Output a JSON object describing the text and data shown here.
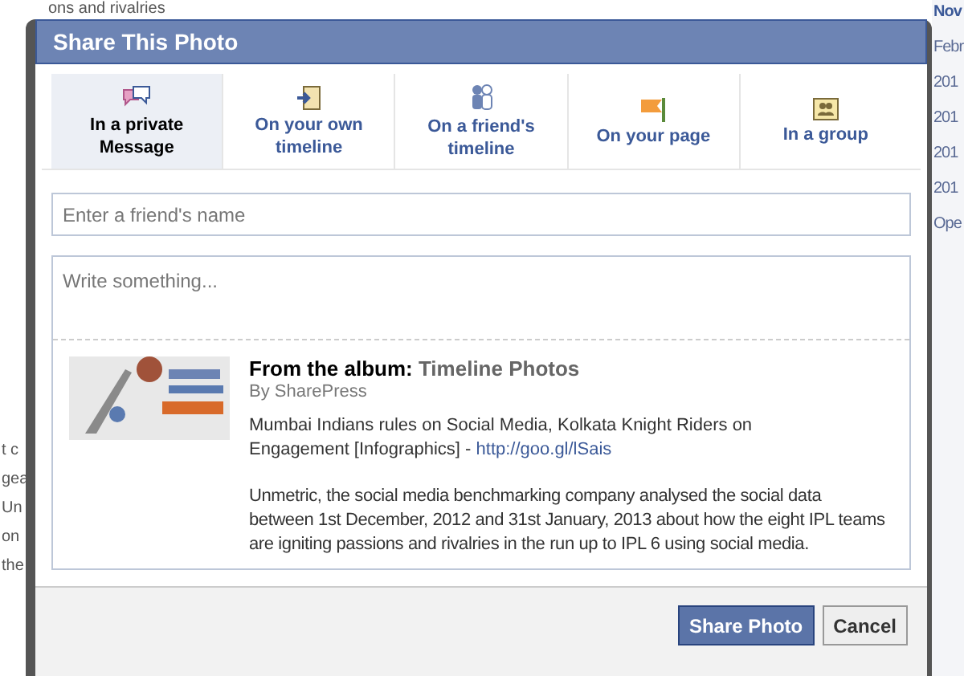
{
  "background": {
    "top_fragment": "ons and rivalries",
    "left_fragments": [
      "t c",
      "gea",
      "Un",
      "on",
      "the"
    ],
    "right_fragments": [
      "Nov",
      "Febr",
      "201",
      "201",
      "201",
      "201",
      "Ope"
    ]
  },
  "dialog": {
    "title": "Share This Photo",
    "tabs": [
      {
        "label": "In a private Message",
        "selected": true,
        "kind": "message"
      },
      {
        "label": "On your own timeline",
        "selected": false,
        "kind": "timeline"
      },
      {
        "label": "On a friend's timeline",
        "selected": false,
        "kind": "friend"
      },
      {
        "label": "On your page",
        "selected": false,
        "kind": "page"
      },
      {
        "label": "In a group",
        "selected": false,
        "kind": "group"
      }
    ],
    "friend_field": {
      "placeholder": "Enter a friend's name"
    },
    "message_field": {
      "placeholder": "Write something..."
    },
    "attachment": {
      "album_label": "From the album:",
      "album_name": "Timeline Photos",
      "byline": "By SharePress",
      "title": "Mumbai Indians rules on Social Media, Kolkata Knight Riders on Engagement [Infographics] -",
      "link": "http://goo.gl/lSais",
      "description": "Unmetric, the social media benchmarking company analysed the social data between 1st December, 2012 and 31st January, 2013 about how the eight IPL teams are igniting passions and rivalries in the run up to IPL 6 using social media."
    },
    "buttons": [
      {
        "label": "Share Photo",
        "kind": "primary"
      },
      {
        "label": "Cancel",
        "kind": "secondary"
      }
    ]
  }
}
